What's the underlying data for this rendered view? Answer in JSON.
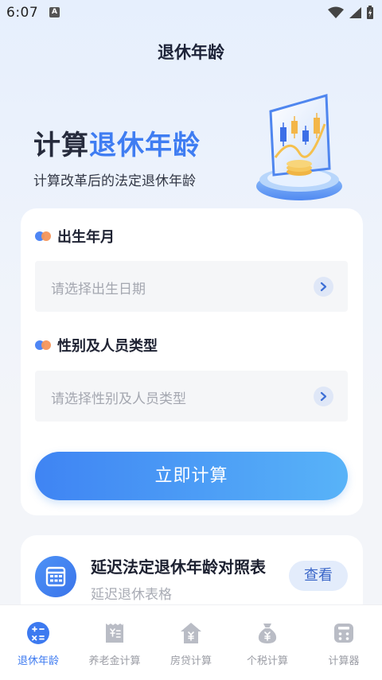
{
  "status_bar": {
    "time": "6:07",
    "notif_icon": "A"
  },
  "header": {
    "title": "退休年龄"
  },
  "hero": {
    "title_part1": "计算",
    "title_part2": "退休年龄",
    "subtitle": "计算改革后的法定退休年龄"
  },
  "form": {
    "birth_label": "出生年月",
    "birth_placeholder": "请选择出生日期",
    "type_label": "性别及人员类型",
    "type_placeholder": "请选择性别及人员类型",
    "submit_label": "立即计算"
  },
  "table_card": {
    "title": "延迟法定退休年龄对照表",
    "subtitle": "延迟退休表格",
    "button_label": "查看"
  },
  "bottom_nav": {
    "items": [
      {
        "label": "退休年龄",
        "icon": "calculator-ops-icon",
        "active": true
      },
      {
        "label": "养老金计算",
        "icon": "receipt-icon",
        "active": false
      },
      {
        "label": "房贷计算",
        "icon": "house-yen-icon",
        "active": false
      },
      {
        "label": "个税计算",
        "icon": "money-bag-icon",
        "active": false
      },
      {
        "label": "计算器",
        "icon": "calculator-icon",
        "active": false
      }
    ]
  },
  "colors": {
    "accent": "#3f7df2",
    "button_gradient_start": "#3f84f3",
    "button_gradient_end": "#58b3f8",
    "nav_active": "#3d7af0",
    "nav_inactive": "#9a9ca4"
  }
}
